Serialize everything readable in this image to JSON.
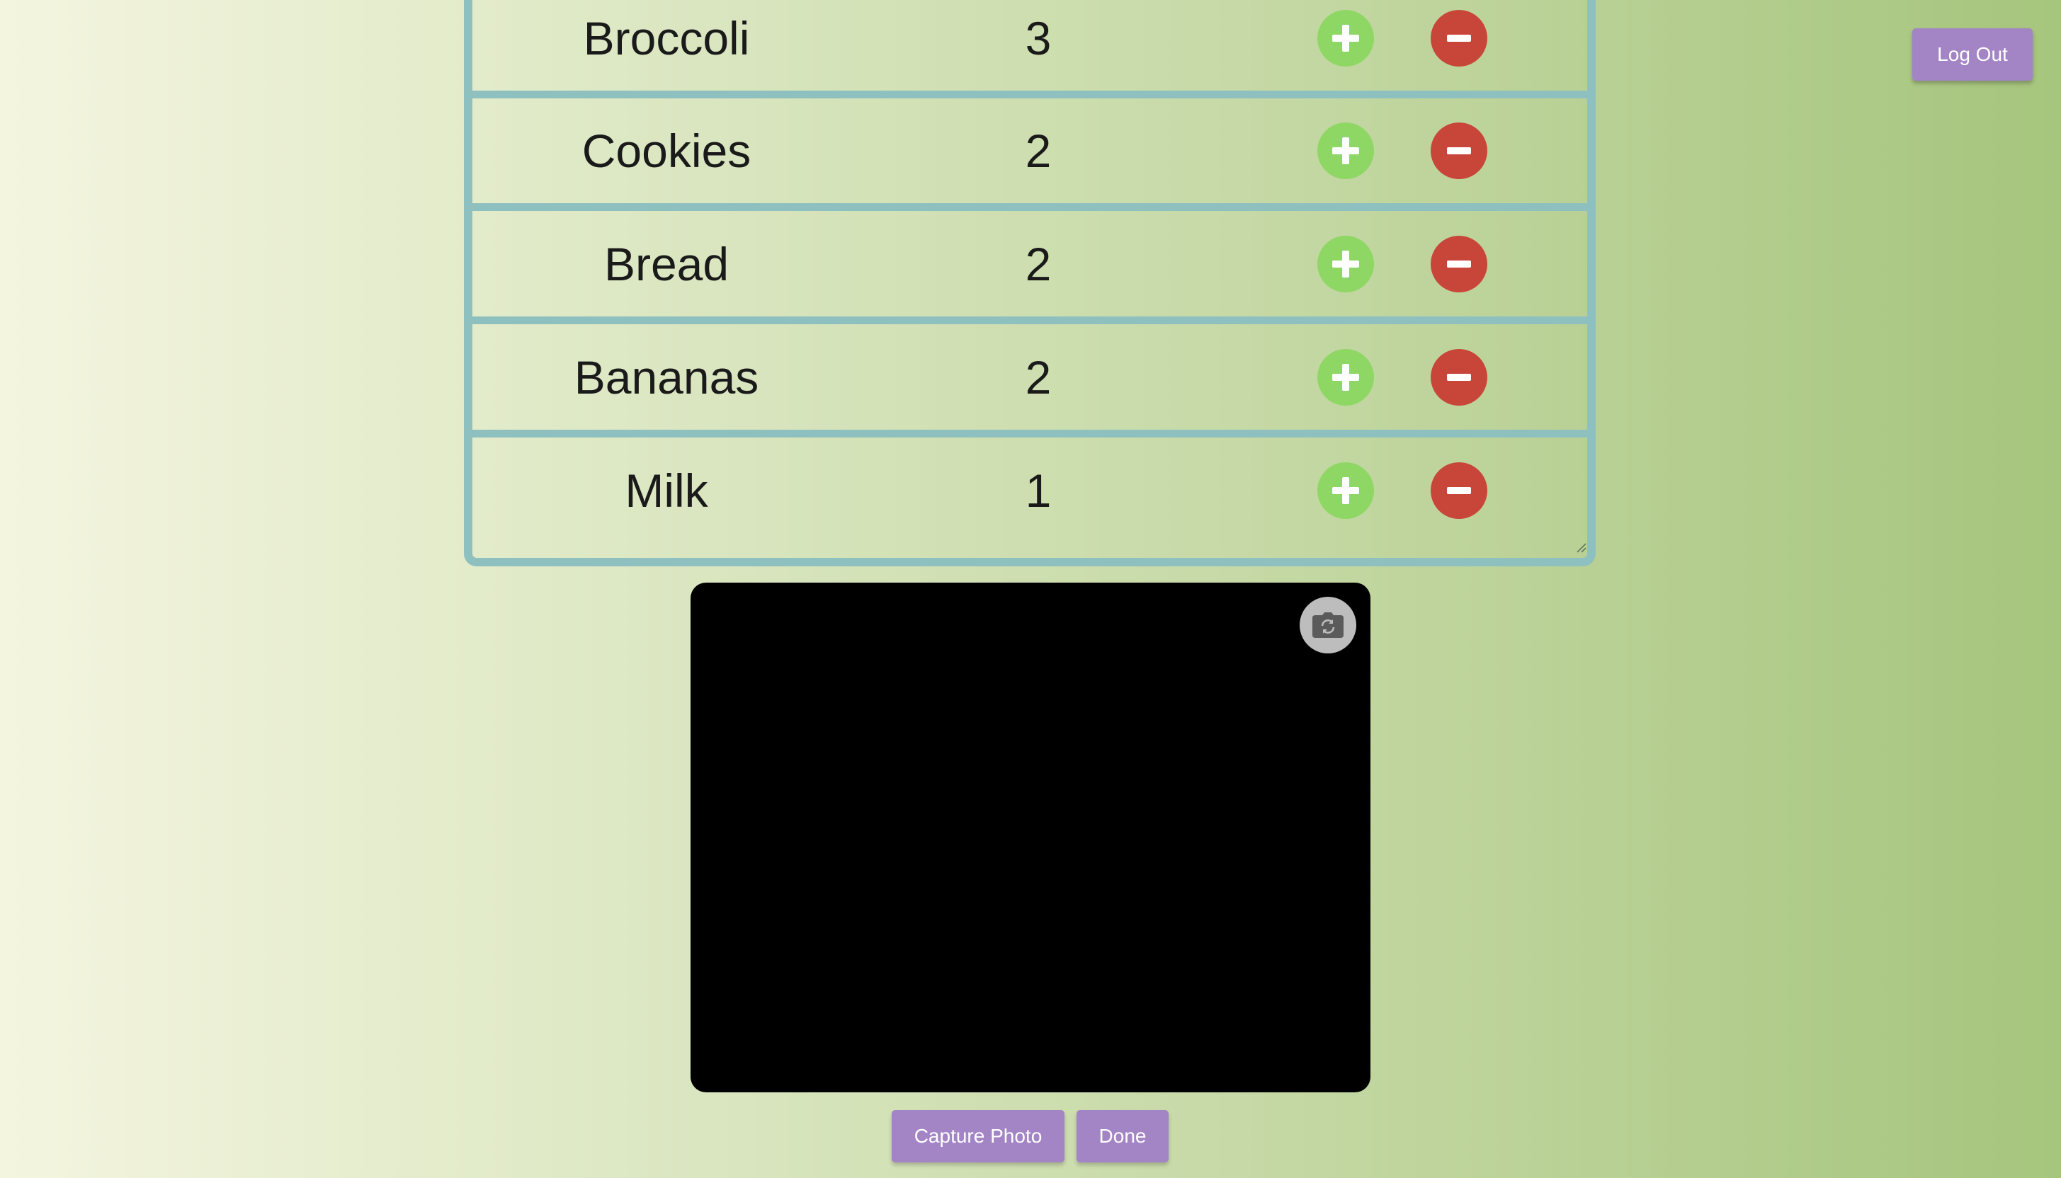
{
  "header": {
    "logout_label": "Log Out"
  },
  "inventory": {
    "items": [
      {
        "name": "Broccoli",
        "quantity": "3"
      },
      {
        "name": "Cookies",
        "quantity": "2"
      },
      {
        "name": "Bread",
        "quantity": "2"
      },
      {
        "name": "Bananas",
        "quantity": "2"
      },
      {
        "name": "Milk",
        "quantity": "1"
      }
    ],
    "increment_icon": "plus-icon",
    "decrement_icon": "minus-icon"
  },
  "camera": {
    "switch_icon": "camera-switch-icon"
  },
  "actions": {
    "capture_label": "Capture Photo",
    "done_label": "Done"
  },
  "colors": {
    "accent_button": "#a385c6",
    "increment": "#8fd764",
    "decrement": "#c84639",
    "table_border": "#8fc0c0",
    "camera_background": "#000000"
  }
}
